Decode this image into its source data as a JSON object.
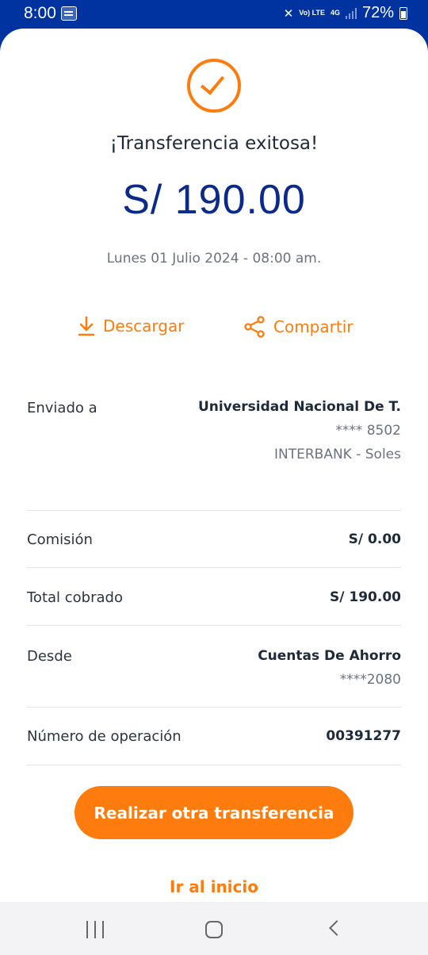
{
  "status_bar": {
    "time": "8:00",
    "battery": "72%",
    "network": "4G",
    "volte": "Vo) LTE"
  },
  "result": {
    "title": "¡Transferencia exitosa!",
    "amount": "S/ 190.00",
    "date": "Lunes 01 Julio 2024 - 08:00 am."
  },
  "actions": {
    "download": "Descargar",
    "share": "Compartir"
  },
  "details": {
    "sent_to": {
      "label": "Enviado a",
      "name": "Universidad Nacional De T.",
      "account": "**** 8502",
      "bank": "INTERBANK - Soles"
    },
    "commission": {
      "label": "Comisión",
      "value": "S/ 0.00"
    },
    "total": {
      "label": "Total cobrado",
      "value": "S/ 190.00"
    },
    "from": {
      "label": "Desde",
      "account_name": "Cuentas De Ahorro",
      "account": "****2080"
    },
    "operation": {
      "label": "Número de operación",
      "value": "00391277"
    }
  },
  "buttons": {
    "primary": "Realizar otra transferencia",
    "home": "Ir al inicio"
  },
  "colors": {
    "brand_blue": "#0033a0",
    "accent_orange": "#fe7b0d",
    "amount_blue": "#0b2a8a"
  },
  "icons": {
    "success": "check-circle-icon",
    "download": "download-icon",
    "share": "share-icon"
  }
}
